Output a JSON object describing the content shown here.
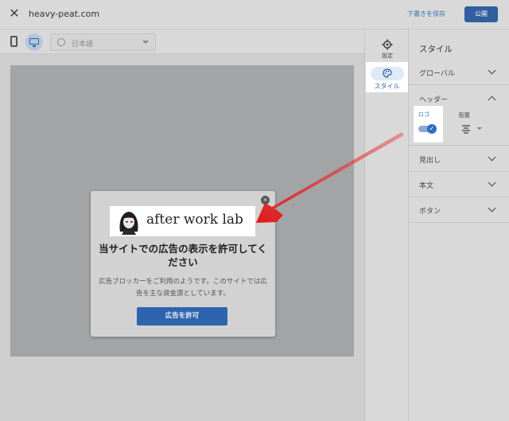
{
  "header": {
    "close_icon": "close-icon",
    "site_name": "heavy-peat.com",
    "save_draft_label": "下書きを保存",
    "publish_label": "公開"
  },
  "toolbar": {
    "device_icons": [
      "phone-icon",
      "desktop-icon"
    ],
    "selected_device": "desktop",
    "language": "日本語"
  },
  "dialog": {
    "logo_text": "after work lab",
    "title": "当サイトでの広告の表示を許可してください",
    "body": "広告ブロッカーをご利用のようです。このサイトでは広告を主な資金源としています。",
    "button_label": "広告を許可"
  },
  "rail": {
    "settings_label": "設定",
    "style_label": "スタイル"
  },
  "panel": {
    "title": "スタイル",
    "sections": {
      "global": "グローバル",
      "header": "ヘッダー",
      "headings": "見出し",
      "body_text": "本文",
      "buttons": "ボタン"
    },
    "header_settings": {
      "logo_label": "ロゴ",
      "logo_enabled": true,
      "alignment_label": "配置",
      "alignment_value": "center"
    }
  },
  "colors": {
    "accent": "#2f5f9e",
    "annotation_arrow": "#e02020",
    "highlight": "#ffffff"
  }
}
